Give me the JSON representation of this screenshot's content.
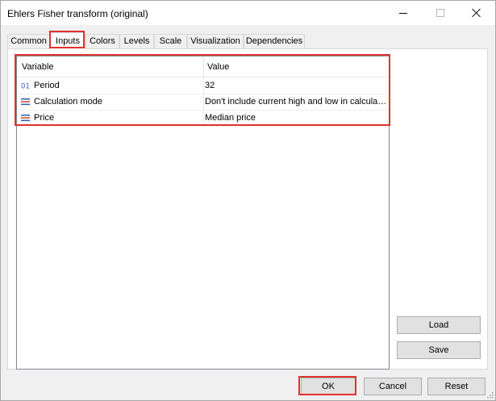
{
  "window": {
    "title": "Ehlers Fisher transform (original)"
  },
  "tabs": [
    {
      "label": "Common"
    },
    {
      "label": "Inputs"
    },
    {
      "label": "Colors"
    },
    {
      "label": "Levels"
    },
    {
      "label": "Scale"
    },
    {
      "label": "Visualization"
    },
    {
      "label": "Dependencies"
    }
  ],
  "active_tab": "Inputs",
  "grid": {
    "headers": {
      "variable": "Variable",
      "value": "Value"
    },
    "rows": [
      {
        "icon": "integer-icon",
        "name": "Period",
        "value": "32"
      },
      {
        "icon": "enum-list-icon",
        "name": "Calculation mode",
        "value": "Don't include current high and low in calculat..."
      },
      {
        "icon": "enum-list-icon",
        "name": "Price",
        "value": "Median price"
      }
    ]
  },
  "side_buttons": {
    "load": "Load",
    "save": "Save"
  },
  "bottom_buttons": {
    "ok": "OK",
    "cancel": "Cancel",
    "reset": "Reset"
  },
  "colors": {
    "highlight": "#e0322f",
    "enum_icon_blue": "#2b5fb3",
    "enum_icon_red": "#d23c2f"
  },
  "icon_glyphs": {
    "integer": "01"
  }
}
